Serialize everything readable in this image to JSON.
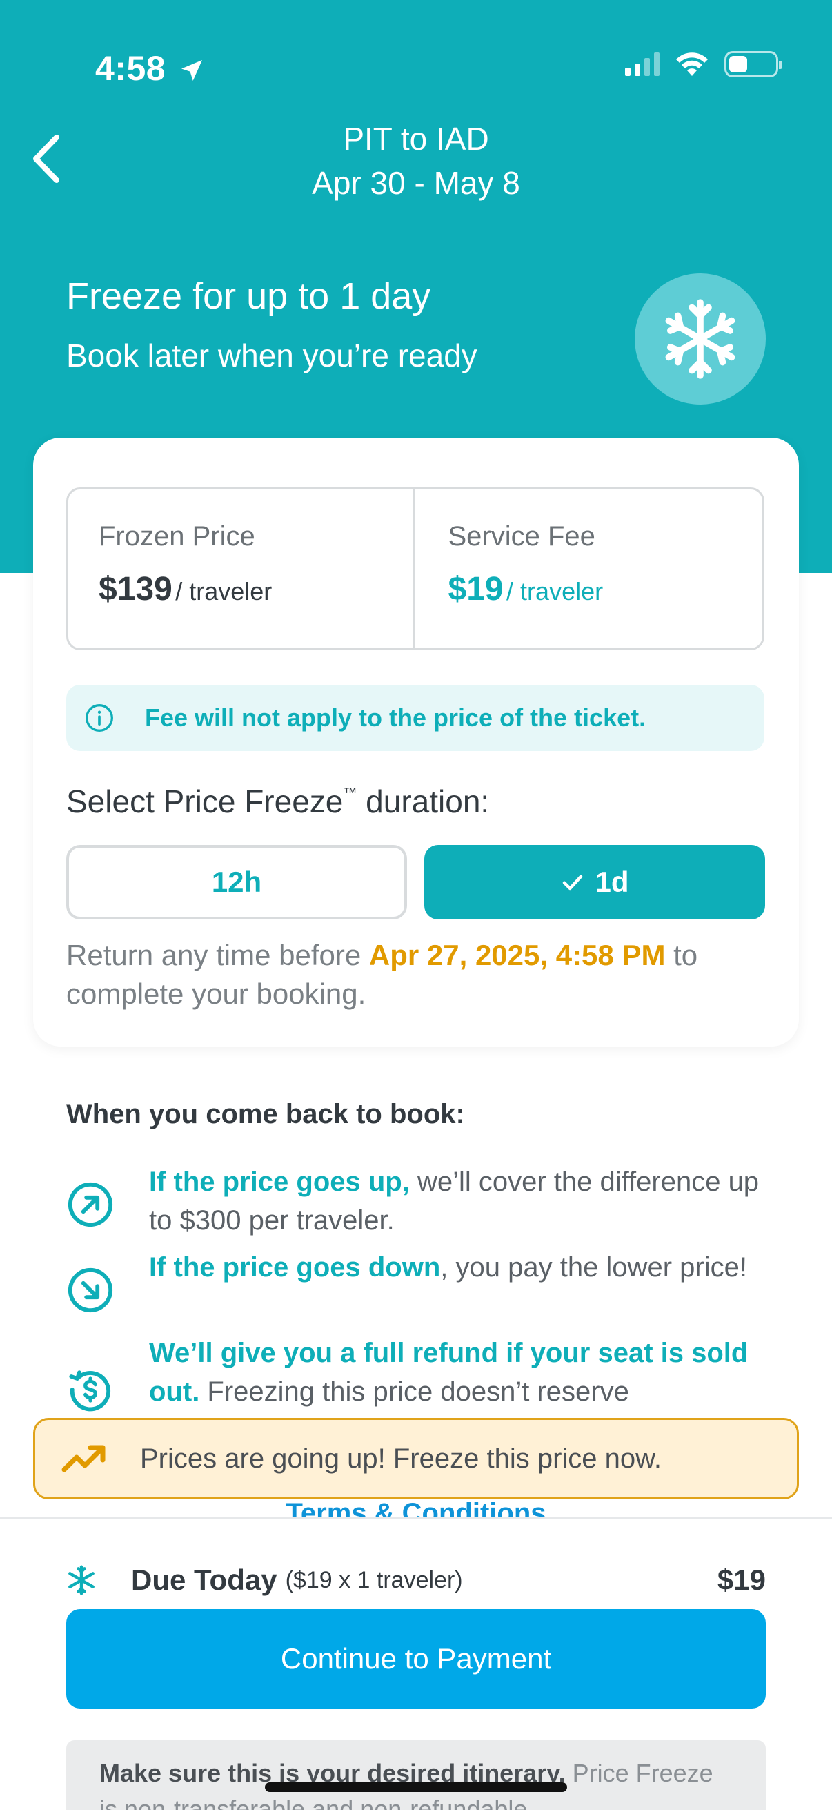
{
  "status_bar": {
    "time": "4:58",
    "battery_level": 0.4,
    "signal_bars": 2
  },
  "header": {
    "route": "PIT to IAD",
    "dates": "Apr 30 - May 8"
  },
  "hero": {
    "title": "Freeze for up to 1 day",
    "subtitle": "Book later when you’re ready"
  },
  "card": {
    "frozen_price": {
      "label": "Frozen Price",
      "amount": "$139",
      "unit": "/ traveler"
    },
    "service_fee": {
      "label": "Service Fee",
      "amount": "$19",
      "unit": "/ traveler"
    },
    "info": "Fee will not apply to the price of the ticket.",
    "duration_title": "Select Price Freeze",
    "duration_tm": "™",
    "duration_suffix": " duration:",
    "options": [
      {
        "label": "12h",
        "selected": false
      },
      {
        "label": "1d",
        "selected": true
      }
    ],
    "return_prefix": "Return any time before ",
    "return_date": "Apr 27, 2025, 4:58 PM",
    "return_suffix": " to complete your booking."
  },
  "benefits": {
    "title": "When you come back to book:",
    "items": [
      {
        "highlight": "If the price goes up,",
        "text": " we’ll cover the difference up to $300 per traveler.",
        "icon": "arrow-up-right-circle-icon"
      },
      {
        "highlight": "If the price goes down",
        "text": ", you pay the lower price!",
        "icon": "arrow-down-right-circle-icon"
      },
      {
        "highlight": "We’ll give you a full refund if your seat is sold out.",
        "text": " Freezing this price doesn’t reserve",
        "icon": "refund-dollar-icon"
      }
    ]
  },
  "terms": "Terms & Conditions",
  "alert": {
    "text": "Prices are going up! Freeze this price now.",
    "icon": "trending-up-icon"
  },
  "footer": {
    "due_label": "Due Today",
    "due_detail": "($19 x 1 traveler)",
    "due_amount": "$19",
    "pay_button": "Continue to Payment",
    "notice_bold": "Make sure this is your desired itinerary.",
    "notice_text": " Price Freeze is non-transferable and non-refundable."
  },
  "colors": {
    "brand": "#0eaeb8",
    "pay": "#00a8e8",
    "warning": "#e19a00"
  }
}
